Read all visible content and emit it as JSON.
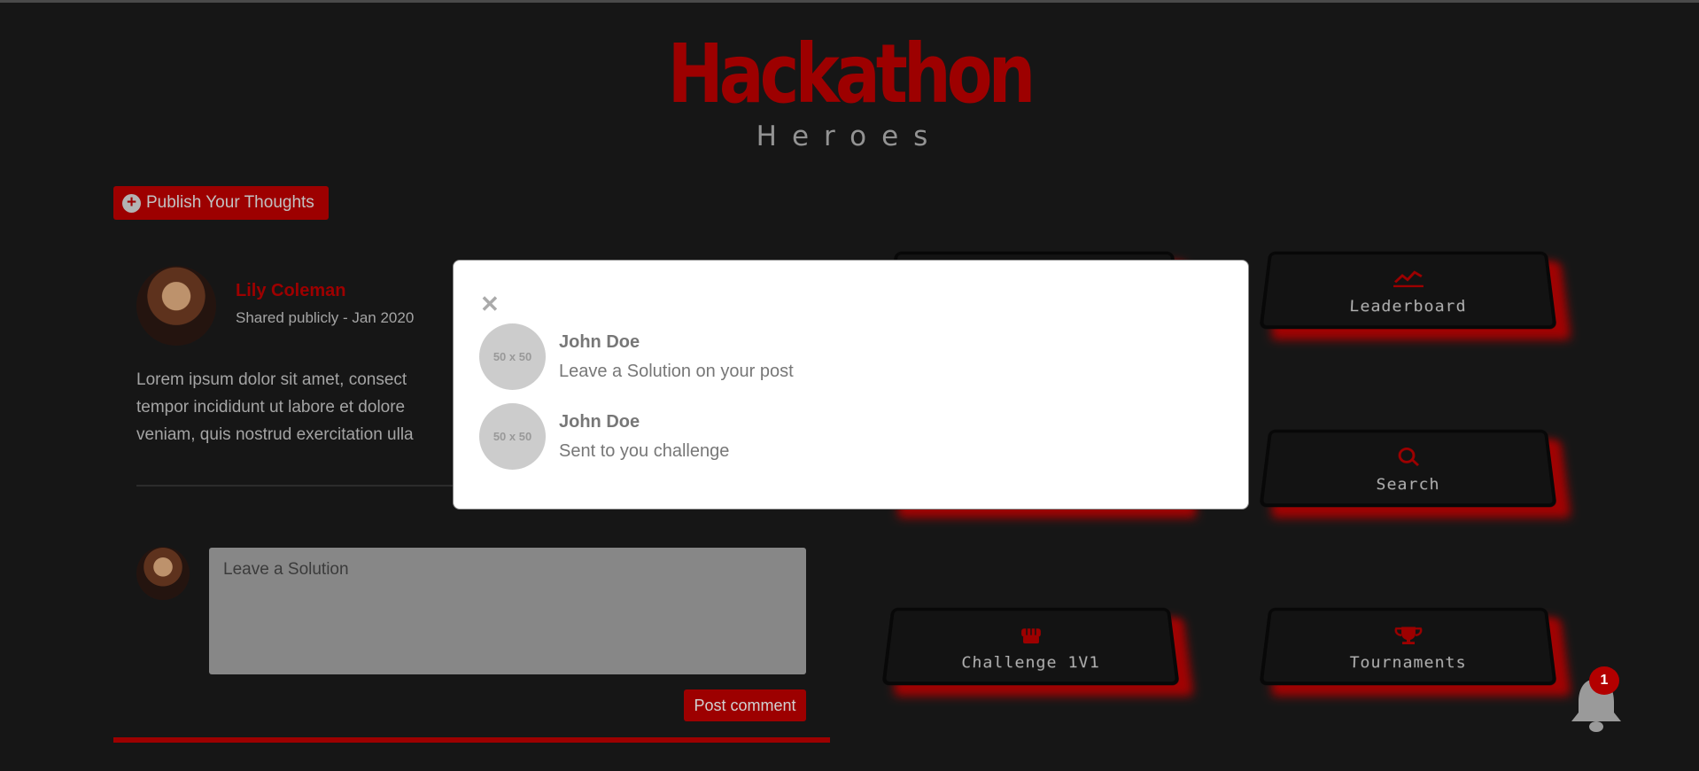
{
  "header": {
    "title": "Hackathon",
    "subtitle": "Heroes"
  },
  "publish": {
    "label": "Publish Your Thoughts"
  },
  "post": {
    "author": "Lily Coleman",
    "meta": "Shared publicly - Jan 2020",
    "body": "Lorem ipsum dolor sit amet, consect\ntempor incididunt ut labore et dolore\nveniam, quis nostrud exercitation ulla",
    "solution_placeholder": "Leave a Solution",
    "post_button": "Post comment"
  },
  "tiles": [
    {
      "label": "",
      "icon": "chart-icon"
    },
    {
      "label": "Leaderboard",
      "icon": "chart-icon"
    },
    {
      "label": "",
      "icon": ""
    },
    {
      "label": "Search",
      "icon": "search-icon"
    },
    {
      "label": "Challenge 1V1",
      "icon": "fist-icon"
    },
    {
      "label": "Tournaments",
      "icon": "trophy-icon"
    }
  ],
  "modal": {
    "notifications": [
      {
        "avatar_text": "50 x 50",
        "name": "John Doe",
        "message": "Leave a Solution on your post"
      },
      {
        "avatar_text": "50 x 50",
        "name": "John Doe",
        "message": "Sent to you challenge"
      }
    ]
  },
  "notifications_badge": {
    "count": "1"
  },
  "colors": {
    "accent": "#b30000",
    "background": "#1a1a1a"
  }
}
